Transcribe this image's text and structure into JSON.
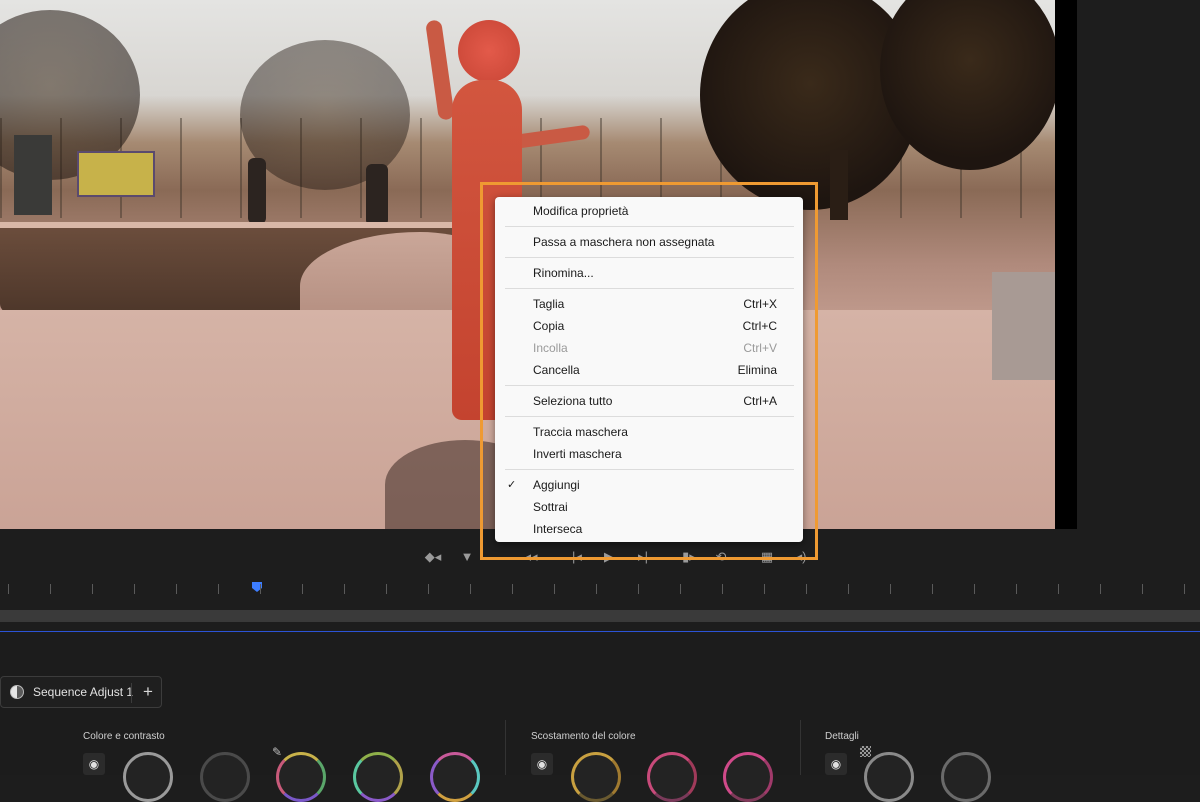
{
  "context_menu": {
    "edit_properties": "Modifica proprietà",
    "switch_unassigned": "Passa a maschera non assegnata",
    "rename": "Rinomina...",
    "cut": {
      "label": "Taglia",
      "shortcut": "Ctrl+X"
    },
    "copy": {
      "label": "Copia",
      "shortcut": "Ctrl+C"
    },
    "paste": {
      "label": "Incolla",
      "shortcut": "Ctrl+V",
      "disabled": true
    },
    "delete": {
      "label": "Cancella",
      "shortcut": "Elimina"
    },
    "select_all": {
      "label": "Seleziona tutto",
      "shortcut": "Ctrl+A"
    },
    "track_mask": "Traccia maschera",
    "invert_mask": "Inverti maschera",
    "add": {
      "label": "Aggiungi",
      "checked": true
    },
    "subtract": "Sottrai",
    "intersect": "Interseca"
  },
  "lumetri": {
    "tab_label": "Sequence Adjust 1",
    "add_tab": "+",
    "sections": {
      "color_contrast": "Colore e contrasto",
      "color_offset": "Scostamento del colore",
      "details": "Dettagli"
    }
  },
  "icons": {
    "checkmark": "✓",
    "eye": "◉",
    "dropper": "✎"
  },
  "colors": {
    "highlight": "#ef9a32",
    "playhead": "#3d7dff",
    "menu_bg": "#f9f9f9"
  }
}
